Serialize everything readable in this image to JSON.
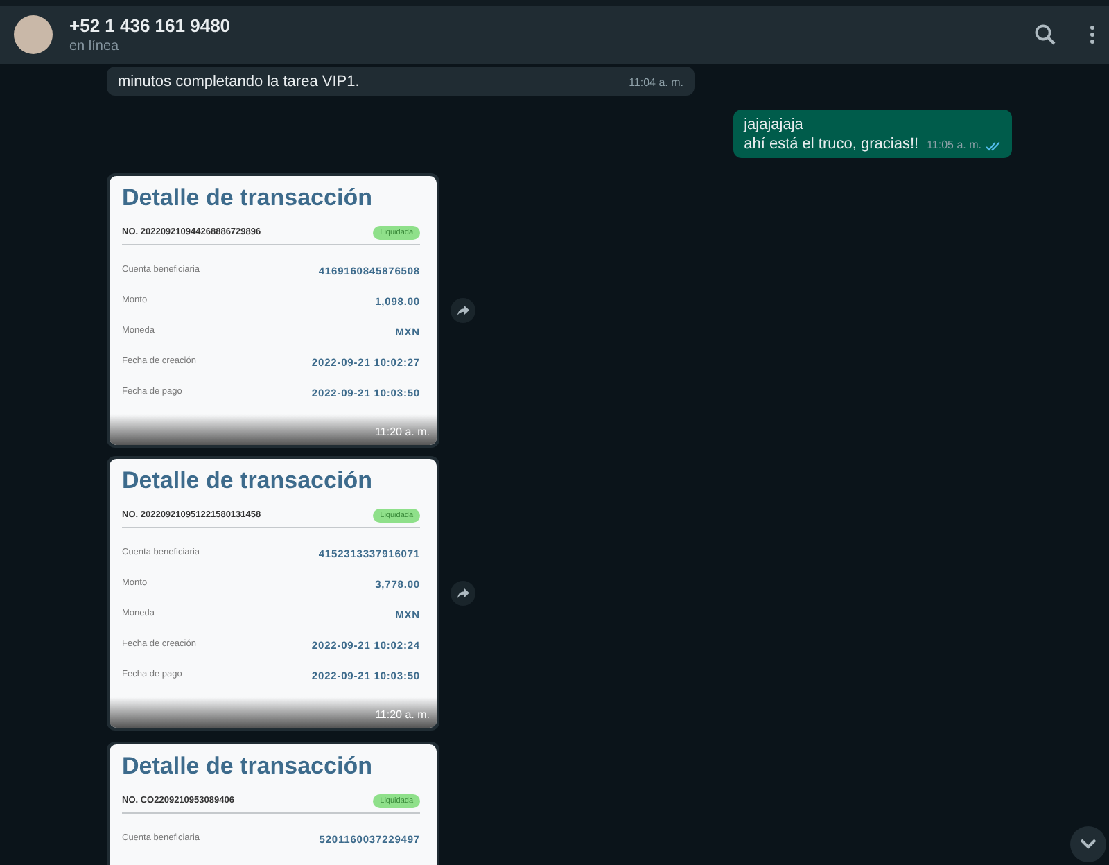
{
  "header": {
    "contact_name": "+52 1 436 161 9480",
    "status": "en línea"
  },
  "messages": [
    {
      "kind": "text",
      "outgoing": false,
      "lines": [
        "minutos completando la tarea VIP1."
      ],
      "time": "11:04 a. m."
    },
    {
      "kind": "text",
      "outgoing": true,
      "lines": [
        "jajajajaja",
        "ahí está el truco, gracias!!"
      ],
      "time": "11:05 a. m.",
      "read": true
    },
    {
      "kind": "receipt",
      "outgoing": false,
      "title": "Detalle de transacción",
      "number": "NO. 202209210944268886729896",
      "badge": "Liquidada",
      "rows": [
        {
          "label": "Cuenta beneficiaria",
          "value": "4169160845876508"
        },
        {
          "label": "Monto",
          "value": "1,098.00"
        },
        {
          "label": "Moneda",
          "value": "MXN"
        },
        {
          "label": "Fecha de creación",
          "value": "2022-09-21 10:02:27"
        },
        {
          "label": "Fecha de pago",
          "value": "2022-09-21 10:03:50"
        }
      ],
      "time": "11:20 a. m."
    },
    {
      "kind": "receipt",
      "outgoing": false,
      "title": "Detalle de transacción",
      "number": "NO. 202209210951221580131458",
      "badge": "Liquidada",
      "rows": [
        {
          "label": "Cuenta beneficiaria",
          "value": "4152313337916071"
        },
        {
          "label": "Monto",
          "value": "3,778.00"
        },
        {
          "label": "Moneda",
          "value": "MXN"
        },
        {
          "label": "Fecha de creación",
          "value": "2022-09-21 10:02:24"
        },
        {
          "label": "Fecha de pago",
          "value": "2022-09-21 10:03:50"
        }
      ],
      "time": "11:20 a. m."
    },
    {
      "kind": "receipt",
      "outgoing": false,
      "title": "Detalle de transacción",
      "number": "NO. CO2209210953089406",
      "badge": "Liquidada",
      "rows": [
        {
          "label": "Cuenta beneficiaria",
          "value": "5201160037229497"
        }
      ]
    }
  ]
}
